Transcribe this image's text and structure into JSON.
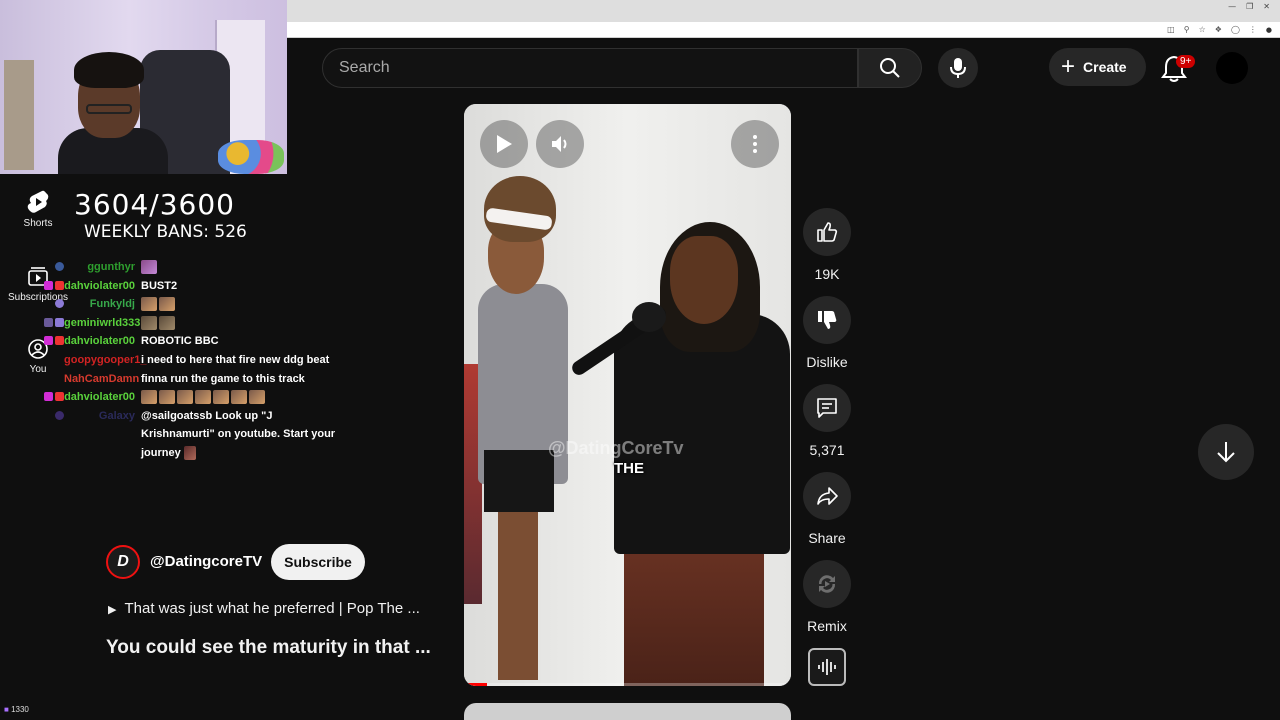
{
  "search": {
    "placeholder": "Search"
  },
  "header": {
    "create_label": "Create",
    "notification_count": "9+"
  },
  "sidebar": {
    "items": [
      {
        "label": "Shorts",
        "icon": "shorts-icon"
      },
      {
        "label": "Subscriptions",
        "icon": "subscriptions-icon"
      },
      {
        "label": "You",
        "icon": "you-icon"
      }
    ]
  },
  "overlay": {
    "counter": "3604/3600",
    "weekly_bans": "WEEKLY BANS: 526",
    "viewer_count": "1330"
  },
  "chat": [
    {
      "user": "ggunthyr",
      "color": "#2e9e2e",
      "msg": ""
    },
    {
      "user": "dahviolater00",
      "color": "#5ad13c",
      "msg": "BUST2"
    },
    {
      "user": "Funkyldj",
      "color": "#37a84a",
      "msg": ""
    },
    {
      "user": "geminiwrld333",
      "color": "#5ad13c",
      "msg": ""
    },
    {
      "user": "dahviolater00",
      "color": "#5ad13c",
      "msg": "ROBOTIC BBC"
    },
    {
      "user": "goopygooper1_",
      "color": "#d12323",
      "msg": "i need to here that fire new ddg beat"
    },
    {
      "user": "NahCamDamn",
      "color": "#d63a2e",
      "msg": "finna run the game to this track"
    },
    {
      "user": "dahviolater00",
      "color": "#5ad13c",
      "msg": ""
    },
    {
      "user": "Galaxy",
      "color": "#2a2a5a",
      "msg": "@sailgoatssb Look up \"J Krishnamurti\" on youtube. Start your journey"
    }
  ],
  "video": {
    "watermark": "@DatingCoreTv",
    "caption": "THE",
    "progress": 0.07
  },
  "channel": {
    "logo_letter": "D",
    "handle": "@DatingcoreTV",
    "subscribe_label": "Subscribe",
    "sound": "That was just what he preferred | Pop The ...",
    "title": "You could see the maturity in that ..."
  },
  "actions": {
    "like_count": "19K",
    "dislike_label": "Dislike",
    "comment_count": "5,371",
    "share_label": "Share",
    "remix_label": "Remix"
  },
  "colors": {
    "background": "#0f0f0f",
    "accent_red": "#cc0000",
    "button_bg": "#272727"
  }
}
